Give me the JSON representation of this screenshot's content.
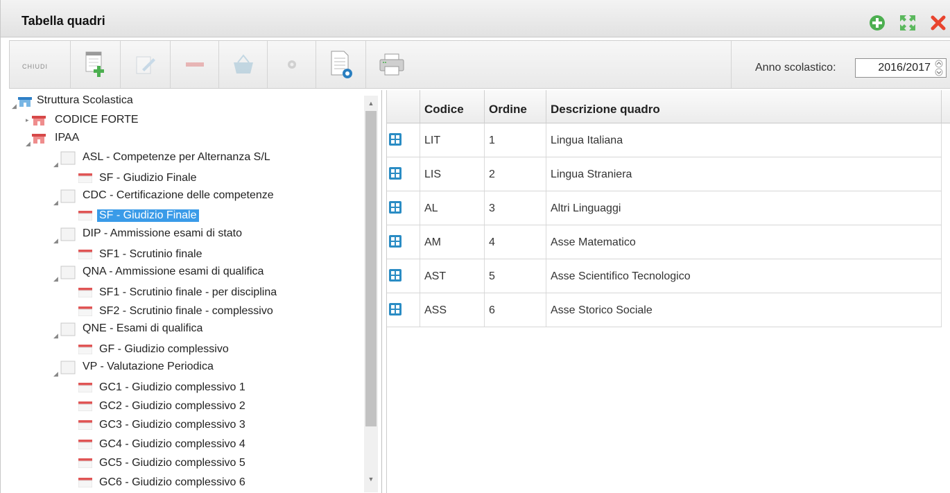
{
  "window": {
    "title": "Tabella quadri"
  },
  "titlebar_icons": [
    "plus-circle-icon",
    "maximize-icon",
    "close-icon"
  ],
  "toolbar": {
    "chiudi_label": "CHIUDI",
    "buttons": [
      "new-document-icon",
      "edit-icon",
      "delete-icon",
      "basket-icon",
      "gear-icon",
      "document-settings-icon",
      "print-icon"
    ],
    "anno_label": "Anno scolastico:",
    "anno_value": "2016/2017"
  },
  "tree": {
    "root": "Struttura Scolastica",
    "school1": "CODICE FORTE",
    "school2": "IPAA",
    "items": [
      {
        "label": "ASL - Competenze per Alternanza S/L",
        "children": [
          "SF - Giudizio Finale"
        ]
      },
      {
        "label": "CDC - Certificazione delle competenze",
        "children": [
          "SF - Giudizio Finale"
        ]
      },
      {
        "label": "DIP - Ammissione esami di stato",
        "children": [
          "SF1 - Scrutinio finale"
        ]
      },
      {
        "label": "QNA - Ammissione esami di qualifica",
        "children": [
          "SF1 - Scrutinio finale - per disciplina",
          "SF2 - Scrutinio finale - complessivo"
        ]
      },
      {
        "label": "QNE - Esami di qualifica",
        "children": [
          "GF - Giudizio complessivo"
        ]
      },
      {
        "label": "VP - Valutazione Periodica",
        "children": [
          "GC1 - Giudizio complessivo 1",
          "GC2 - Giudizio complessivo 2",
          "GC3 - Giudizio complessivo 3",
          "GC4 - Giudizio complessivo 4",
          "GC5 - Giudizio complessivo 5",
          "GC6 - Giudizio complessivo 6"
        ]
      }
    ],
    "selected": "CDC / SF - Giudizio Finale"
  },
  "grid": {
    "columns": [
      "Codice",
      "Ordine",
      "Descrizione quadro"
    ],
    "rows": [
      {
        "codice": "LIT",
        "ordine": "1",
        "descrizione": "Lingua Italiana"
      },
      {
        "codice": "LIS",
        "ordine": "2",
        "descrizione": "Lingua Straniera"
      },
      {
        "codice": "AL",
        "ordine": "3",
        "descrizione": "Altri Linguaggi"
      },
      {
        "codice": "AM",
        "ordine": "4",
        "descrizione": "Asse Matematico"
      },
      {
        "codice": "AST",
        "ordine": "5",
        "descrizione": "Asse Scientifico Tecnologico"
      },
      {
        "codice": "ASS",
        "ordine": "6",
        "descrizione": "Asse Storico Sociale"
      }
    ]
  },
  "colors": {
    "accent_green": "#4caf50",
    "close_red": "#e8442e",
    "selection_blue": "#3a9be8",
    "row_icon_teal": "#2a8cc4"
  }
}
